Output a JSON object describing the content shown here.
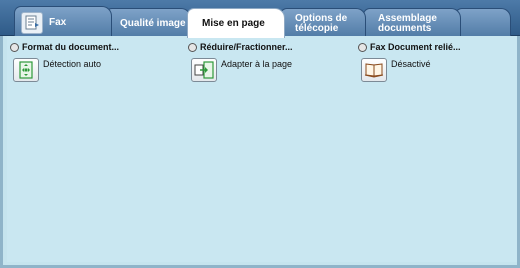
{
  "tabs": [
    {
      "id": "fax",
      "label": "Fax"
    },
    {
      "id": "qualite",
      "label": "Qualité image"
    },
    {
      "id": "mise",
      "label": "Mise en page"
    },
    {
      "id": "options",
      "label": "Options de\ntélécopie"
    },
    {
      "id": "assemblage",
      "label": "Assemblage\ndocuments"
    }
  ],
  "active_tab": "Mise en page",
  "features": [
    {
      "title": "Format du document...",
      "value": "Détection auto",
      "icon": "document-size-icon"
    },
    {
      "title": "Réduire/Fractionner...",
      "value": "Adapter à la page",
      "icon": "fit-to-page-icon"
    },
    {
      "title": "Fax Document relié...",
      "value": "Désactivé",
      "icon": "book-icon"
    }
  ],
  "colors": {
    "tab_strip": "#2f5b88",
    "panel": "#c9e7f1",
    "icon_green": "#2f9a3a"
  }
}
